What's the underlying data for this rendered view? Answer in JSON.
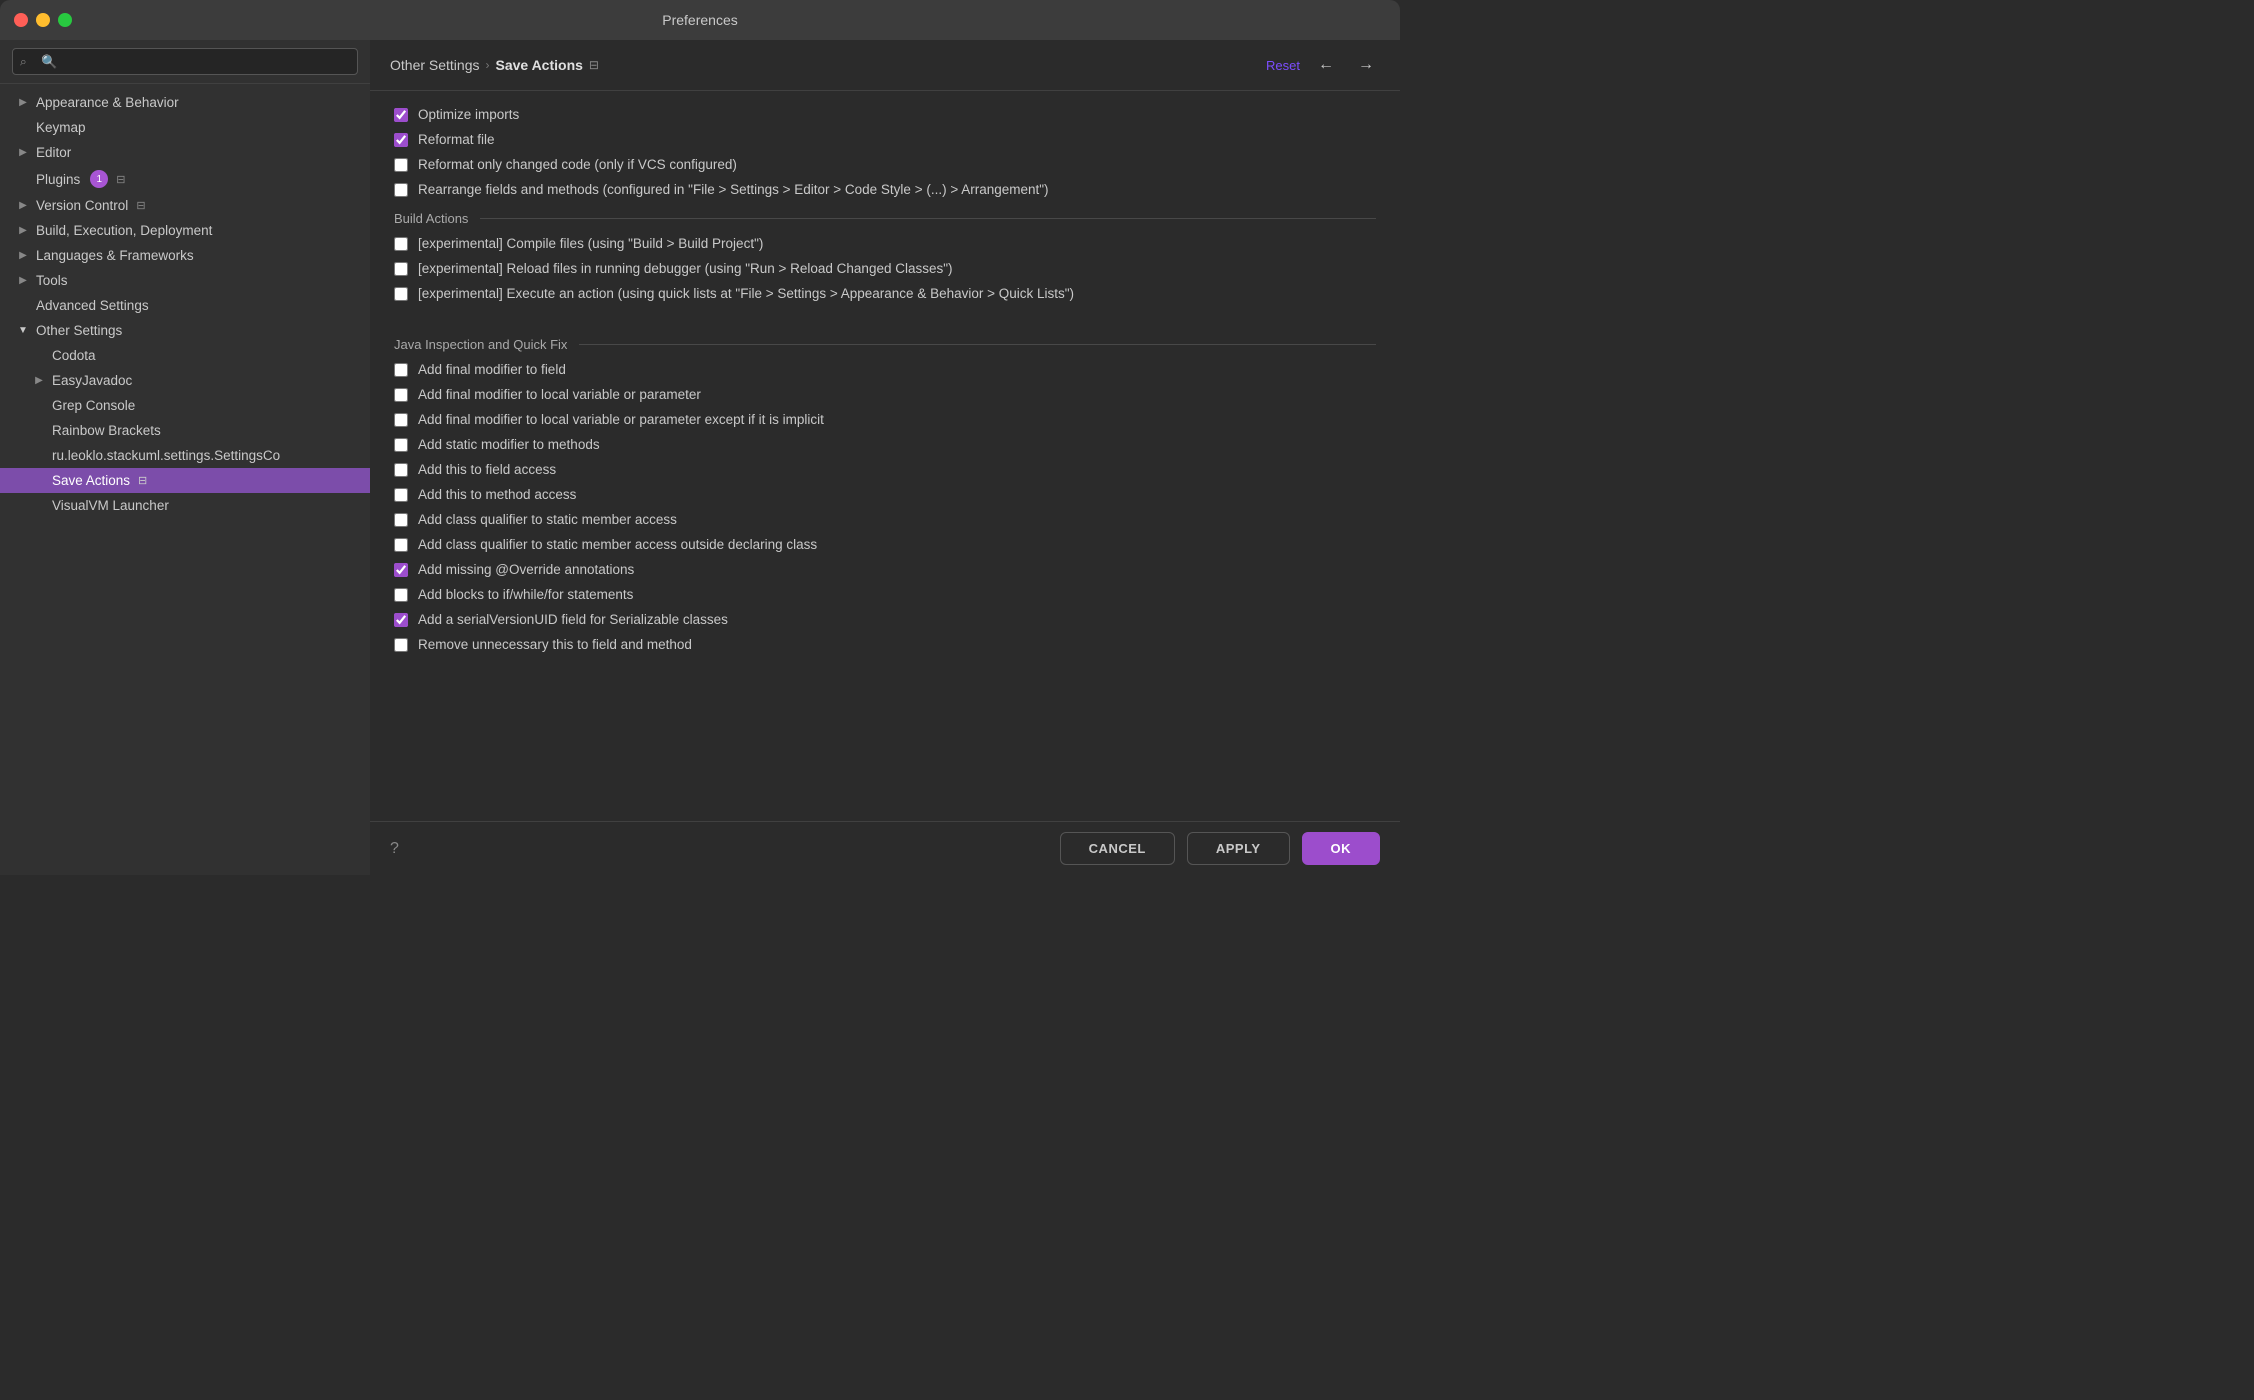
{
  "window": {
    "title": "Preferences"
  },
  "sidebar": {
    "search_placeholder": "🔍",
    "items": [
      {
        "id": "appearance",
        "label": "Appearance & Behavior",
        "indent": 0,
        "expandable": true,
        "expanded": false
      },
      {
        "id": "keymap",
        "label": "Keymap",
        "indent": 0,
        "expandable": false
      },
      {
        "id": "editor",
        "label": "Editor",
        "indent": 0,
        "expandable": true,
        "expanded": false
      },
      {
        "id": "plugins",
        "label": "Plugins",
        "indent": 0,
        "expandable": false,
        "badge": "1",
        "hasicon": true
      },
      {
        "id": "version-control",
        "label": "Version Control",
        "indent": 0,
        "expandable": true,
        "expanded": false,
        "hasicon": true
      },
      {
        "id": "build",
        "label": "Build, Execution, Deployment",
        "indent": 0,
        "expandable": true,
        "expanded": false
      },
      {
        "id": "languages",
        "label": "Languages & Frameworks",
        "indent": 0,
        "expandable": true,
        "expanded": false
      },
      {
        "id": "tools",
        "label": "Tools",
        "indent": 0,
        "expandable": true,
        "expanded": false
      },
      {
        "id": "advanced",
        "label": "Advanced Settings",
        "indent": 0,
        "expandable": false
      },
      {
        "id": "other",
        "label": "Other Settings",
        "indent": 0,
        "expandable": true,
        "expanded": true
      },
      {
        "id": "codota",
        "label": "Codota",
        "indent": 1,
        "expandable": false
      },
      {
        "id": "easyjavadoc",
        "label": "EasyJavadoc",
        "indent": 1,
        "expandable": true,
        "expanded": false
      },
      {
        "id": "grepconsole",
        "label": "Grep Console",
        "indent": 1,
        "expandable": false
      },
      {
        "id": "rainbowbrackets",
        "label": "Rainbow Brackets",
        "indent": 1,
        "expandable": false
      },
      {
        "id": "ru-leoklo",
        "label": "ru.leoklo.stackuml.settings.SettingsCo",
        "indent": 1,
        "expandable": false
      },
      {
        "id": "saveactions",
        "label": "Save Actions",
        "indent": 1,
        "expandable": false,
        "active": true,
        "hasicon": true
      },
      {
        "id": "visualvm",
        "label": "VisualVM Launcher",
        "indent": 1,
        "expandable": false
      }
    ]
  },
  "breadcrumb": {
    "parent": "Other Settings",
    "separator": "›",
    "current": "Save Actions"
  },
  "header": {
    "reset_label": "Reset",
    "back_label": "←",
    "forward_label": "→"
  },
  "checkboxes": {
    "optimize_imports": {
      "label": "Optimize imports",
      "checked": true
    },
    "reformat_file": {
      "label": "Reformat file",
      "checked": true
    },
    "reformat_changed": {
      "label": "Reformat only changed code (only if VCS configured)",
      "checked": false
    },
    "rearrange": {
      "label": "Rearrange fields and methods (configured in \"File > Settings > Editor > Code Style > (...) > Arrangement\")",
      "checked": false
    }
  },
  "sections": {
    "build_actions": "Build Actions",
    "java_inspection": "Java Inspection and Quick Fix"
  },
  "build_checkboxes": [
    {
      "id": "compile",
      "label": "[experimental] Compile files (using \"Build > Build Project\")",
      "checked": false
    },
    {
      "id": "reload",
      "label": "[experimental] Reload files in running debugger (using \"Run > Reload Changed Classes\")",
      "checked": false
    },
    {
      "id": "execute",
      "label": "[experimental] Execute an action (using quick lists at \"File > Settings > Appearance & Behavior > Quick Lists\")",
      "checked": false
    }
  ],
  "java_checkboxes": [
    {
      "id": "final-field",
      "label": "Add final modifier to field",
      "checked": false
    },
    {
      "id": "final-local",
      "label": "Add final modifier to local variable or parameter",
      "checked": false
    },
    {
      "id": "final-local-implicit",
      "label": "Add final modifier to local variable or parameter except if it is implicit",
      "checked": false
    },
    {
      "id": "static-methods",
      "label": "Add static modifier to methods",
      "checked": false
    },
    {
      "id": "this-field",
      "label": "Add this to field access",
      "checked": false
    },
    {
      "id": "this-method",
      "label": "Add this to method access",
      "checked": false
    },
    {
      "id": "class-qualifier",
      "label": "Add class qualifier to static member access",
      "checked": false
    },
    {
      "id": "class-qualifier-outside",
      "label": "Add class qualifier to static member access outside declaring class",
      "checked": false
    },
    {
      "id": "override",
      "label": "Add missing @Override annotations",
      "checked": true
    },
    {
      "id": "blocks",
      "label": "Add blocks to if/while/for statements",
      "checked": false
    },
    {
      "id": "serial",
      "label": "Add a serialVersionUID field for Serializable classes",
      "checked": true
    },
    {
      "id": "remove-this",
      "label": "Remove unnecessary this to field and method",
      "checked": false
    }
  ],
  "footer": {
    "help_label": "?",
    "cancel_label": "CANCEL",
    "apply_label": "APPLY",
    "ok_label": "OK"
  }
}
